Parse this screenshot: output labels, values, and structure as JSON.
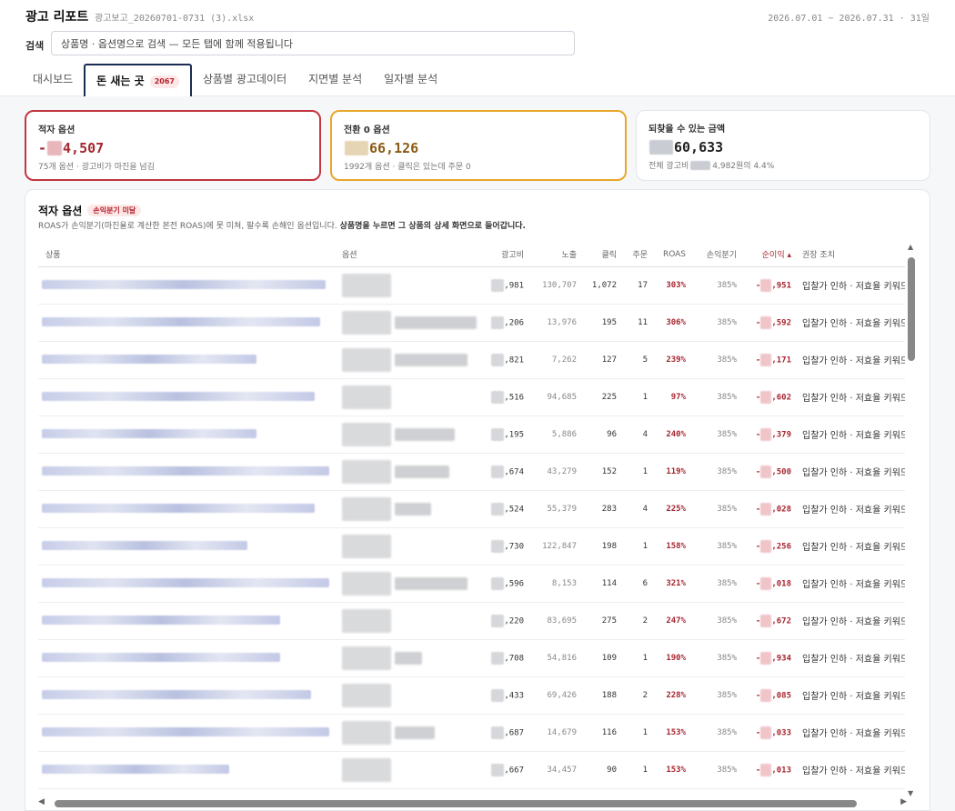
{
  "header": {
    "app_title": "광고 리포트",
    "file_name": "광고보고_20260701-0731 (3).xlsx",
    "date_range": "2026.07.01 ~ 2026.07.31 · 31일"
  },
  "search": {
    "label": "검색",
    "value": "상품명 · 옵션명으로 검색 — 모든 탭에 함께 적용됩니다"
  },
  "tabs": [
    {
      "label": "대시보드"
    },
    {
      "label": "돈 새는 곳",
      "badge": "2067"
    },
    {
      "label": "상품별 광고데이터"
    },
    {
      "label": "지면별 분석"
    },
    {
      "label": "일자별 분석"
    }
  ],
  "cards": {
    "deficit": {
      "label": "적자 옵션",
      "prefix": "-",
      "value": "4,507",
      "sub": "75개 옵션 · 광고비가 마진을 넘김"
    },
    "zero_conv": {
      "label": "전환 0 옵션",
      "value": "66,126",
      "sub": "1992개 옵션 · 클릭은 있는데 주문 0"
    },
    "recoverable": {
      "label": "되찾을 수 있는 금액",
      "value": "60,633",
      "sub_prefix": "전체 광고비",
      "sub_suffix": "4,982원의 4.4%"
    }
  },
  "panel": {
    "title": "적자 옵션",
    "badge": "손익분기 미달",
    "desc_a": "ROAS가 손익분기(마진율로 계산한 본전 ROAS)에 못 미쳐, 팔수록 손해인 옵션입니다. ",
    "desc_b": "상품명을 누르면 그 상품의 상세 화면으로 들어갑니다."
  },
  "table": {
    "headers": [
      "상품",
      "옵션",
      "광고비",
      "노출",
      "클릭",
      "주문",
      "ROAS",
      "손익분기",
      "순이익 ▴",
      "권장 조치"
    ],
    "rows": [
      {
        "ad": ",981",
        "imp": "130,707",
        "clk": "1,072",
        "ord": "17",
        "roas": "303%",
        "be": "385%",
        "loss": ",951",
        "act": "입찰가 인하 · 저효율 키워드"
      },
      {
        "ad": ",206",
        "imp": "13,976",
        "clk": "195",
        "ord": "11",
        "roas": "306%",
        "be": "385%",
        "loss": ",592",
        "act": "입찰가 인하 · 저효율 키워드"
      },
      {
        "ad": ",821",
        "imp": "7,262",
        "clk": "127",
        "ord": "5",
        "roas": "239%",
        "be": "385%",
        "loss": ",171",
        "act": "입찰가 인하 · 저효율 키워드"
      },
      {
        "ad": ",516",
        "imp": "94,685",
        "clk": "225",
        "ord": "1",
        "roas": "97%",
        "be": "385%",
        "loss": ",602",
        "act": "입찰가 인하 · 저효율 키워드"
      },
      {
        "ad": ",195",
        "imp": "5,886",
        "clk": "96",
        "ord": "4",
        "roas": "240%",
        "be": "385%",
        "loss": ",379",
        "act": "입찰가 인하 · 저효율 키워드"
      },
      {
        "ad": ",674",
        "imp": "43,279",
        "clk": "152",
        "ord": "1",
        "roas": "119%",
        "be": "385%",
        "loss": ",500",
        "act": "입찰가 인하 · 저효율 키워드"
      },
      {
        "ad": ",524",
        "imp": "55,379",
        "clk": "283",
        "ord": "4",
        "roas": "225%",
        "be": "385%",
        "loss": ",028",
        "act": "입찰가 인하 · 저효율 키워드"
      },
      {
        "ad": ",730",
        "imp": "122,847",
        "clk": "198",
        "ord": "1",
        "roas": "158%",
        "be": "385%",
        "loss": ",256",
        "act": "입찰가 인하 · 저효율 키워드"
      },
      {
        "ad": ",596",
        "imp": "8,153",
        "clk": "114",
        "ord": "6",
        "roas": "321%",
        "be": "385%",
        "loss": ",018",
        "act": "입찰가 인하 · 저효율 키워드"
      },
      {
        "ad": ",220",
        "imp": "83,695",
        "clk": "275",
        "ord": "2",
        "roas": "247%",
        "be": "385%",
        "loss": ",672",
        "act": "입찰가 인하 · 저효율 키워드"
      },
      {
        "ad": ",708",
        "imp": "54,816",
        "clk": "109",
        "ord": "1",
        "roas": "190%",
        "be": "385%",
        "loss": ",934",
        "act": "입찰가 인하 · 저효율 키워드"
      },
      {
        "ad": ",433",
        "imp": "69,426",
        "clk": "188",
        "ord": "2",
        "roas": "228%",
        "be": "385%",
        "loss": ",085",
        "act": "입찰가 인하 · 저효율 키워드"
      },
      {
        "ad": ",687",
        "imp": "14,679",
        "clk": "116",
        "ord": "1",
        "roas": "153%",
        "be": "385%",
        "loss": ",033",
        "act": "입찰가 인하 · 저효율 키워드"
      },
      {
        "ad": ",667",
        "imp": "34,457",
        "clk": "90",
        "ord": "1",
        "roas": "153%",
        "be": "385%",
        "loss": ",013",
        "act": "입찰가 인하 · 저효율 키워드"
      }
    ]
  },
  "icons": {
    "scroll_up": "triangle-up",
    "scroll_down": "triangle-down",
    "scroll_left": "triangle-left",
    "scroll_right": "triangle-right"
  },
  "colors": {
    "deficit_accent": "#c2363f",
    "zero_conv_accent": "#e9a72a",
    "active_tab": "#1b2c54"
  }
}
